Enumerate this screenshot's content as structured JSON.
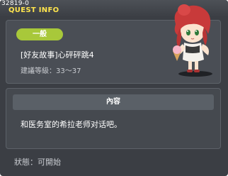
{
  "window": {
    "quest_id": "32819-0",
    "title": "QUEST INFO"
  },
  "header": {
    "tag": "一般",
    "quest_name": "[好友故事]心砰砰跳4",
    "level_range": "建議等級：33～37"
  },
  "content": {
    "heading": "內容",
    "text": "和医务室的希拉老师对话吧。"
  },
  "status": {
    "text": "狀態：可開始"
  },
  "colors": {
    "window_bg": "#3b3e44",
    "title": "#ffe54d",
    "tag": "#a8c83a",
    "panel": "#4a4e55"
  },
  "character": {
    "icon": "npc-girl-red-hair-icon"
  }
}
